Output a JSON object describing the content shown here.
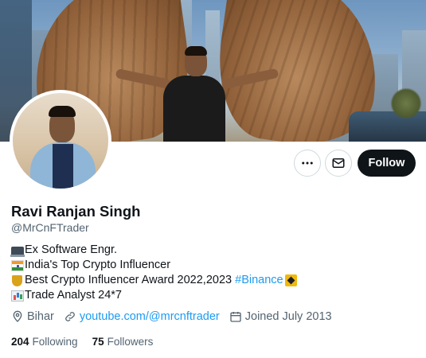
{
  "profile": {
    "name": "Ravi Ranjan Singh",
    "handle": "@MrCnFTrader"
  },
  "actions": {
    "more_icon": "more-icon",
    "mail_icon": "mail-icon",
    "follow_label": "Follow"
  },
  "bio": {
    "line1": {
      "emoji": "laptop-icon",
      "text": "Ex Software Engr."
    },
    "line2": {
      "emoji": "india-flag-icon",
      "text": "India's Top Crypto Influencer"
    },
    "line3": {
      "emoji": "trophy-icon",
      "text": "Best Crypto Influencer Award 2022,2023 ",
      "hashtag": "#Binance",
      "trail_emoji": "binance-icon"
    },
    "line4": {
      "emoji": "bar-chart-icon",
      "text": "Trade Analyst 24*7"
    }
  },
  "meta": {
    "location": "Bihar",
    "website": "youtube.com/@mrcnftrader",
    "joined": "Joined July 2013"
  },
  "stats": {
    "following_count": "204",
    "following_label": "Following",
    "followers_count": "75",
    "followers_label": "Followers"
  },
  "colors": {
    "accent": "#1d9bf0",
    "text": "#0f1419",
    "secondary_text": "#536471",
    "follow_button": "#0f1419"
  }
}
